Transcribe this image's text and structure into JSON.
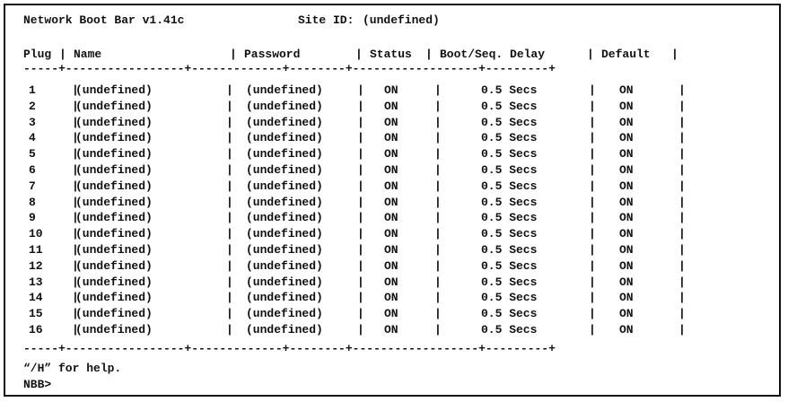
{
  "header": {
    "title": "Network Boot Bar v1.41c",
    "site_label": "Site ID:",
    "site_value": "(undefined)"
  },
  "table": {
    "columns": [
      "Plug",
      "Name",
      "Password",
      "Status",
      "Boot/Seq. Delay",
      "Default"
    ],
    "rows": [
      {
        "plug": "1",
        "name": "(undefined)",
        "password": "(undefined)",
        "status": "ON",
        "delay": "0.5 Secs",
        "default": "ON"
      },
      {
        "plug": "2",
        "name": "(undefined)",
        "password": "(undefined)",
        "status": "ON",
        "delay": "0.5 Secs",
        "default": "ON"
      },
      {
        "plug": "3",
        "name": "(undefined)",
        "password": "(undefined)",
        "status": "ON",
        "delay": "0.5 Secs",
        "default": "ON"
      },
      {
        "plug": "4",
        "name": "(undefined)",
        "password": "(undefined)",
        "status": "ON",
        "delay": "0.5 Secs",
        "default": "ON"
      },
      {
        "plug": "5",
        "name": "(undefined)",
        "password": "(undefined)",
        "status": "ON",
        "delay": "0.5 Secs",
        "default": "ON"
      },
      {
        "plug": "6",
        "name": "(undefined)",
        "password": "(undefined)",
        "status": "ON",
        "delay": "0.5 Secs",
        "default": "ON"
      },
      {
        "plug": "7",
        "name": "(undefined)",
        "password": "(undefined)",
        "status": "ON",
        "delay": "0.5 Secs",
        "default": "ON"
      },
      {
        "plug": "8",
        "name": "(undefined)",
        "password": "(undefined)",
        "status": "ON",
        "delay": "0.5 Secs",
        "default": "ON"
      },
      {
        "plug": "9",
        "name": "(undefined)",
        "password": "(undefined)",
        "status": "ON",
        "delay": "0.5 Secs",
        "default": "ON"
      },
      {
        "plug": "10",
        "name": "(undefined)",
        "password": "(undefined)",
        "status": "ON",
        "delay": "0.5 Secs",
        "default": "ON"
      },
      {
        "plug": "11",
        "name": "(undefined)",
        "password": "(undefined)",
        "status": "ON",
        "delay": "0.5 Secs",
        "default": "ON"
      },
      {
        "plug": "12",
        "name": "(undefined)",
        "password": "(undefined)",
        "status": "ON",
        "delay": "0.5 Secs",
        "default": "ON"
      },
      {
        "plug": "13",
        "name": "(undefined)",
        "password": "(undefined)",
        "status": "ON",
        "delay": "0.5 Secs",
        "default": "ON"
      },
      {
        "plug": "14",
        "name": "(undefined)",
        "password": "(undefined)",
        "status": "ON",
        "delay": "0.5 Secs",
        "default": "ON"
      },
      {
        "plug": "15",
        "name": "(undefined)",
        "password": "(undefined)",
        "status": "ON",
        "delay": "0.5 Secs",
        "default": "ON"
      },
      {
        "plug": "16",
        "name": "(undefined)",
        "password": "(undefined)",
        "status": "ON",
        "delay": "0.5 Secs",
        "default": "ON"
      }
    ]
  },
  "footer": {
    "help_text": "“/H” for help.",
    "prompt": "NBB>"
  }
}
